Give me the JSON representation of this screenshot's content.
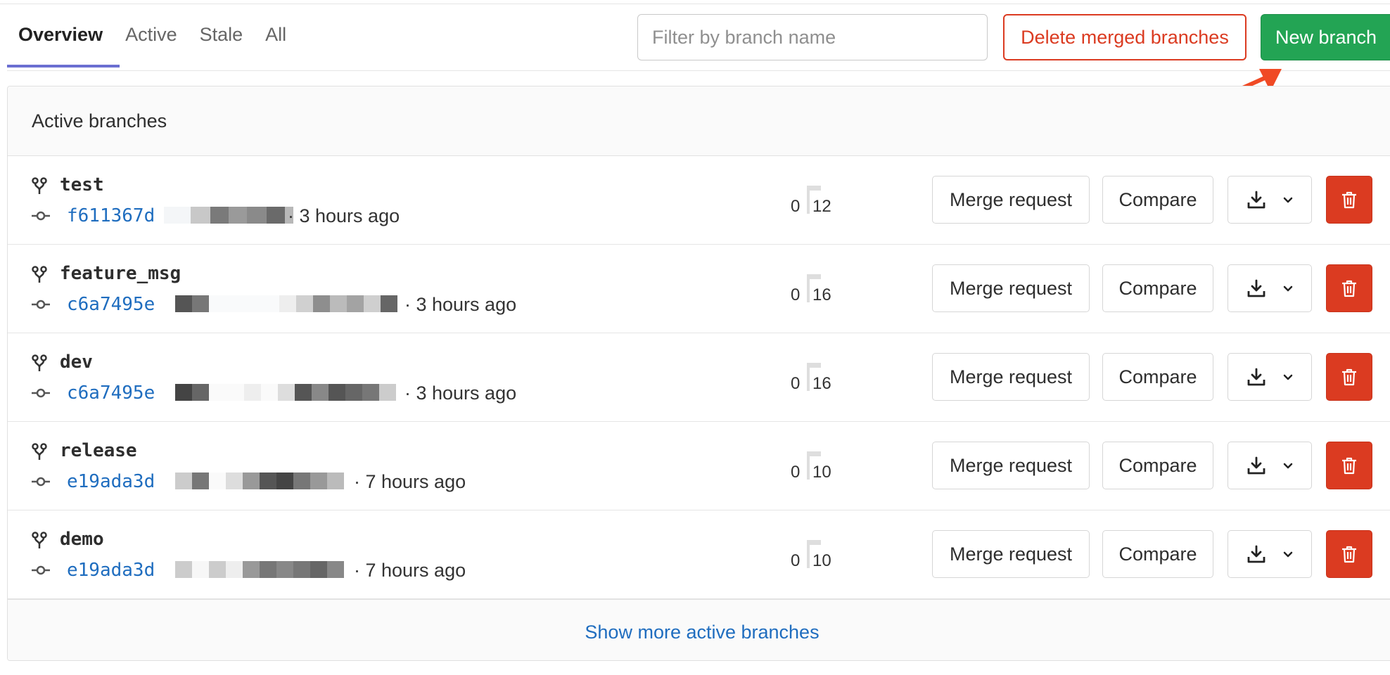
{
  "tabs": [
    {
      "label": "Overview",
      "active": true
    },
    {
      "label": "Active",
      "active": false
    },
    {
      "label": "Stale",
      "active": false
    },
    {
      "label": "All",
      "active": false
    }
  ],
  "filter": {
    "placeholder": "Filter by branch name",
    "value": ""
  },
  "actions": {
    "delete_merged_label": "Delete merged branches",
    "new_branch_label": "New branch"
  },
  "panel": {
    "title": "Active branches",
    "show_more_label": "Show more active branches"
  },
  "row_buttons": {
    "merge_request_label": "Merge request",
    "compare_label": "Compare"
  },
  "branches": [
    {
      "name": "test",
      "sha": "f611367d",
      "time": "· 3 hours ago",
      "behind": "0",
      "ahead": "12"
    },
    {
      "name": "feature_msg",
      "sha": "c6a7495e",
      "time": "· 3 hours ago",
      "behind": "0",
      "ahead": "16"
    },
    {
      "name": "dev",
      "sha": "c6a7495e",
      "time": "· 3 hours ago",
      "behind": "0",
      "ahead": "16"
    },
    {
      "name": "release",
      "sha": "e19ada3d",
      "time": "· 7 hours ago",
      "behind": "0",
      "ahead": "10"
    },
    {
      "name": "demo",
      "sha": "e19ada3d",
      "time": "· 7 hours ago",
      "behind": "0",
      "ahead": "10"
    }
  ],
  "colors": {
    "accent": "#6b6fd1",
    "success": "#23a454",
    "danger": "#db3b21",
    "link": "#1f6dbf"
  },
  "icons": {
    "branch": "git-branch-icon",
    "commit": "git-commit-icon",
    "download": "download-icon",
    "chevron": "chevron-down-icon",
    "delete": "trash-icon"
  }
}
